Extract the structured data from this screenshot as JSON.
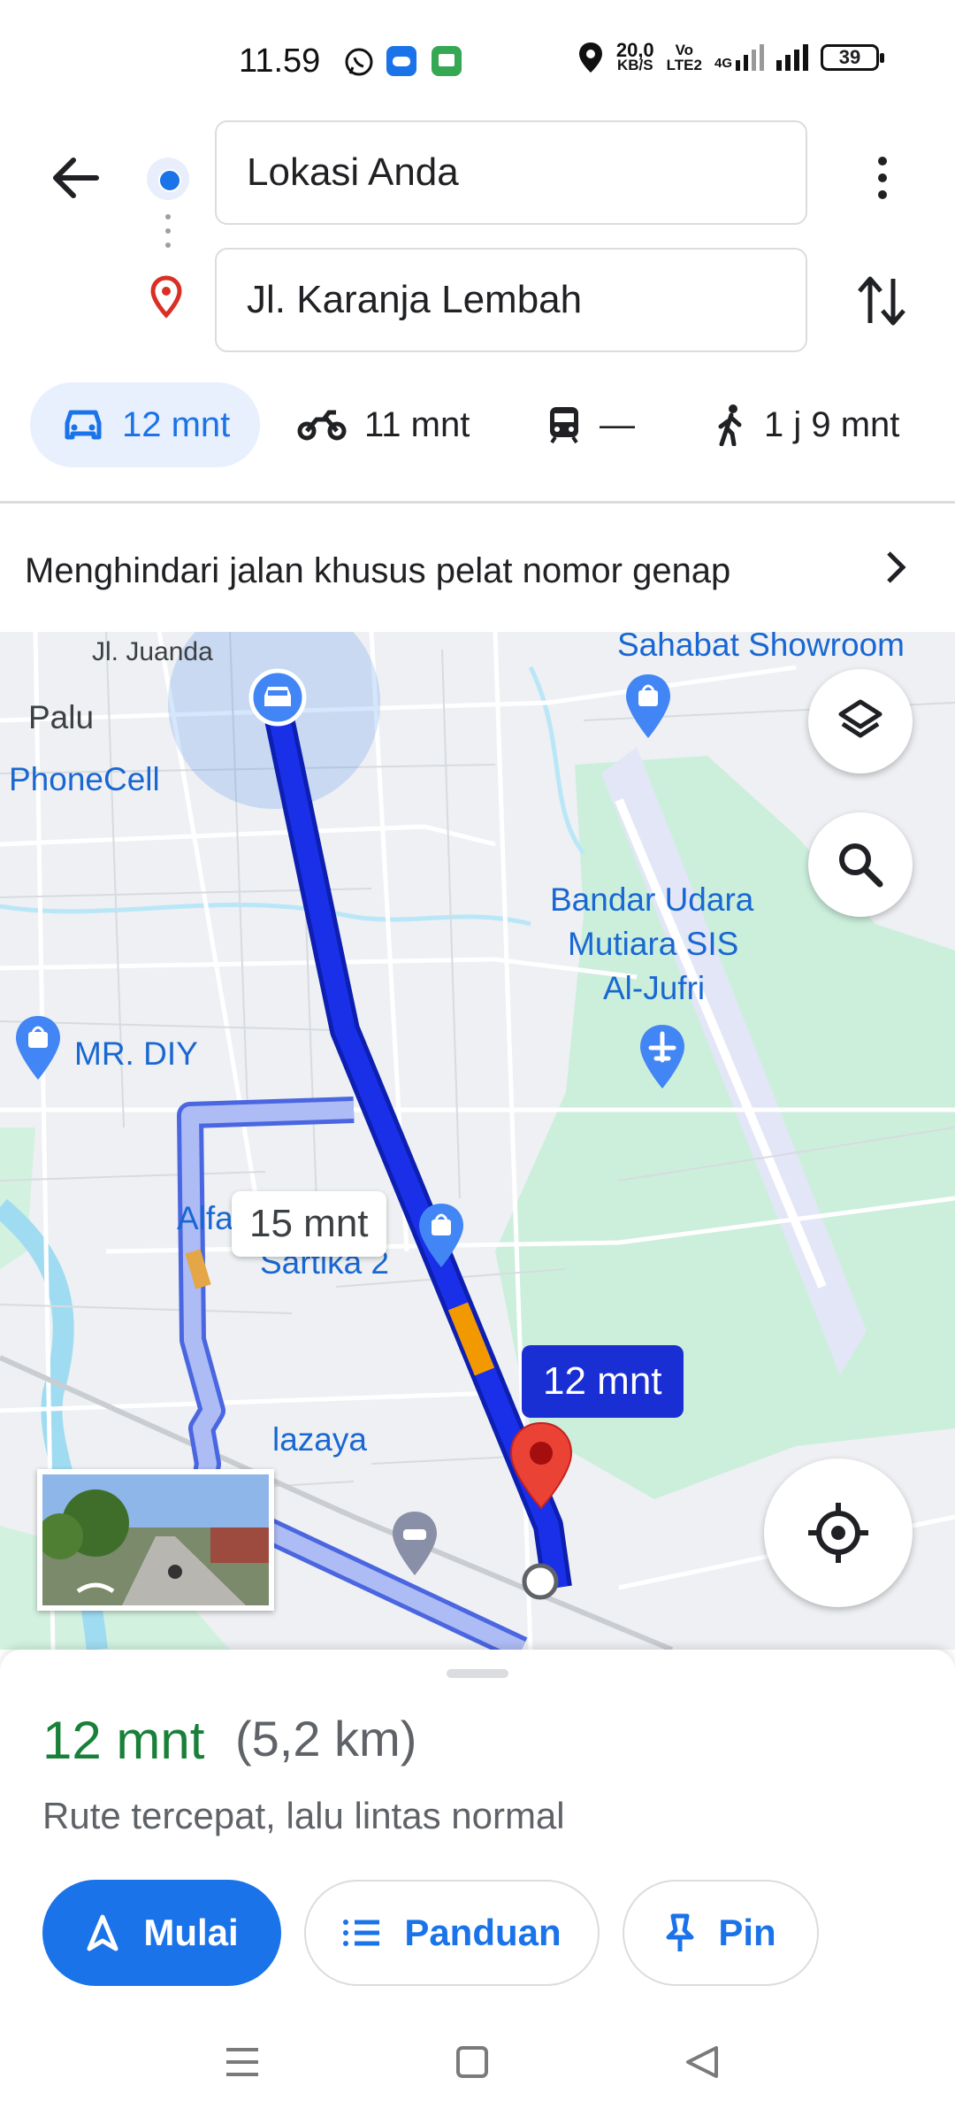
{
  "status_bar": {
    "time": "11.59",
    "net_speed_value": "20,0",
    "net_speed_unit": "KB/S",
    "volte_top": "Vo",
    "volte_bottom": "LTE2",
    "network": "4G",
    "battery": "39"
  },
  "directions": {
    "origin_text": "Lokasi Anda",
    "destination_text": "Jl. Karanja Lembah"
  },
  "modes": [
    {
      "label": "12 mnt",
      "icon": "car-icon",
      "selected": true
    },
    {
      "label": "11 mnt",
      "icon": "motorcycle-icon",
      "selected": false
    },
    {
      "label": "—",
      "icon": "transit-icon",
      "selected": false
    },
    {
      "label": "1 j 9 mnt",
      "icon": "walk-icon",
      "selected": false
    }
  ],
  "notice": {
    "text": "Menghindari jalan khusus pelat nomor genap"
  },
  "map": {
    "labels": {
      "juanda": "Jl. Juanda",
      "palu": "Palu",
      "phonecell": "PhoneCell",
      "sahabat": "Sahabat Showroom",
      "bandara_1": "Bandar Udara",
      "bandara_2": "Mutiara SIS",
      "bandara_3": "Al-Jufri",
      "mrdiy": "MR. DIY",
      "alfa": "Alfa",
      "sartika": "Sartika 2",
      "hazaya": "lazaya"
    },
    "eta_alternate": "15 mnt",
    "eta_primary": "12 mnt",
    "colors": {
      "route_primary": "#1a2fd3",
      "route_alternate": "#8ea2f2",
      "traffic_slow": "#f29900",
      "park": "#ccefdc",
      "water": "#9fdcf2"
    }
  },
  "summary": {
    "time": "12 mnt",
    "distance": "(5,2 km)",
    "description": "Rute tercepat, lalu lintas normal"
  },
  "actions": {
    "start_label": "Mulai",
    "steps_label": "Panduan",
    "pin_label": "Pin"
  }
}
